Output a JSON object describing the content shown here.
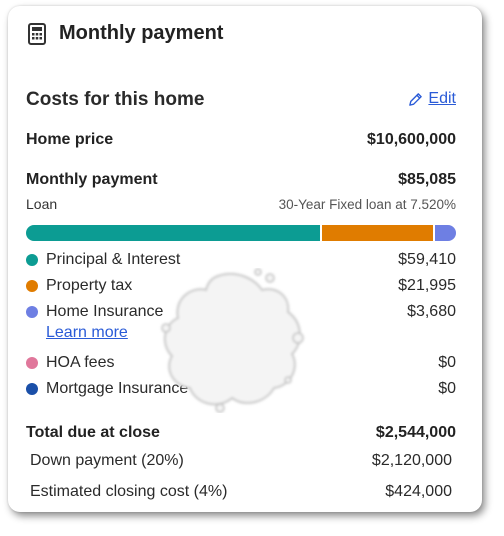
{
  "header": {
    "title": "Monthly payment",
    "icon": "calculator-icon"
  },
  "section": {
    "title": "Costs for this home",
    "edit_label": "Edit",
    "edit_icon": "pencil-icon"
  },
  "home_price": {
    "label": "Home price",
    "value": "$10,600,000"
  },
  "monthly": {
    "label": "Monthly payment",
    "value": "$85,085",
    "loan_label": "Loan",
    "loan_detail": "30-Year Fixed loan at 7.520%"
  },
  "breakdown": {
    "bar_colors": [
      "#0c9c93",
      "#e07c00",
      "#6e7fe3"
    ],
    "items": [
      {
        "label": "Principal & Interest",
        "value": "$59,410",
        "color": "#0c9c93"
      },
      {
        "label": "Property tax",
        "value": "$21,995",
        "color": "#e07c00"
      },
      {
        "label": "Home Insurance",
        "value": "$3,680",
        "color": "#6e7fe3"
      },
      {
        "label": "HOA fees",
        "value": "$0",
        "color": "#e0779b"
      },
      {
        "label": "Mortgage Insurance",
        "value": "$0",
        "color": "#1a4fa8"
      }
    ],
    "learn_more": "Learn more"
  },
  "closing": {
    "label": "Total due at close",
    "value": "$2,544,000",
    "items": [
      {
        "label": "Down payment (20%)",
        "value": "$2,120,000"
      },
      {
        "label": "Estimated closing cost (4%)",
        "value": "$424,000"
      }
    ]
  }
}
